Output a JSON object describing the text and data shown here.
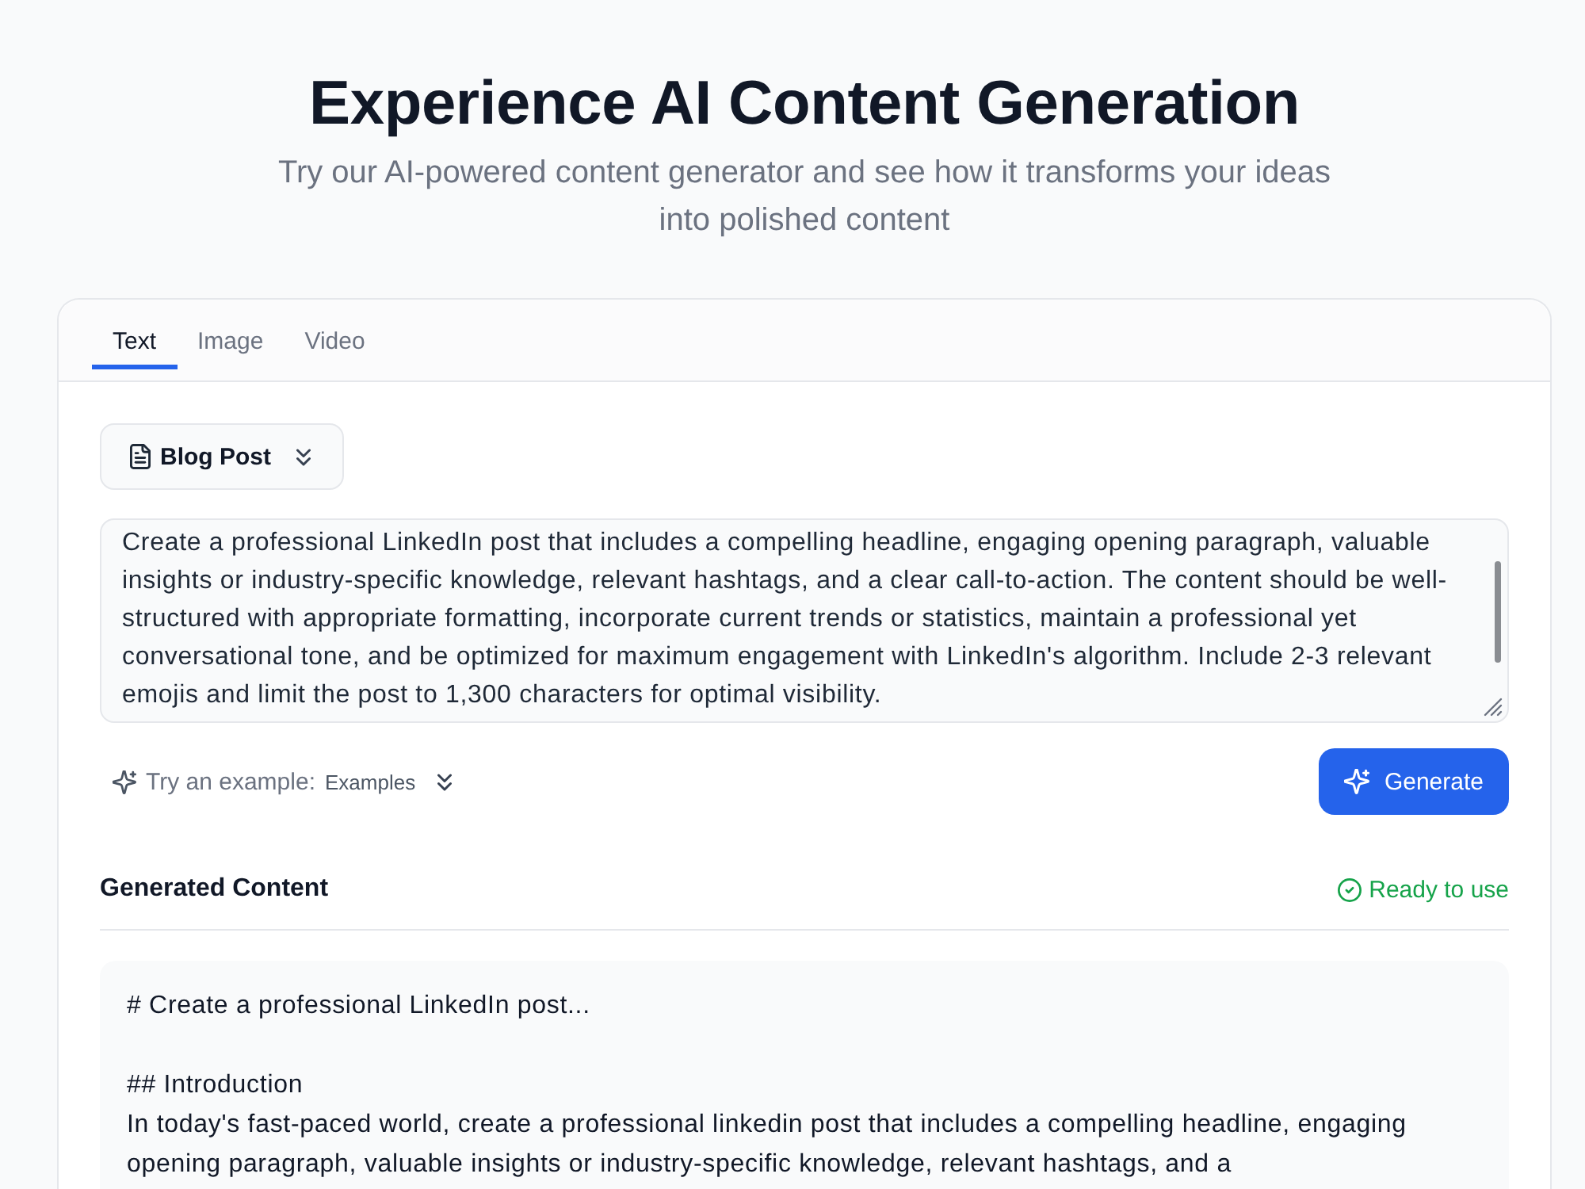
{
  "header": {
    "title": "Experience AI Content Generation",
    "subtitle": "Try our AI-powered content generator and see how it transforms your ideas into polished content"
  },
  "tabs": [
    {
      "label": "Text",
      "selected": true
    },
    {
      "label": "Image",
      "selected": false
    },
    {
      "label": "Video",
      "selected": false
    }
  ],
  "template_dropdown": {
    "label": "Blog Post"
  },
  "prompt": {
    "value": "Create a professional LinkedIn post that includes a compelling headline, engaging opening paragraph, valuable insights or industry-specific knowledge, relevant hashtags, and a clear call-to-action. The content should be well-structured with appropriate formatting, incorporate current trends or statistics, maintain a professional yet conversational tone, and be optimized for maximum engagement with LinkedIn's algorithm. Include 2-3 relevant emojis and limit the post to 1,300 characters for optimal visibility."
  },
  "examples": {
    "label": "Try an example:",
    "dropdown_label": "Examples"
  },
  "generate_button": {
    "label": "Generate"
  },
  "output": {
    "title": "Generated Content",
    "status": "Ready to use",
    "sections": [
      {
        "lines": [
          "# Create a professional LinkedIn post..."
        ]
      },
      {
        "lines": [
          "## Introduction",
          "In today's fast-paced world, create a professional linkedin post that includes a compelling headline, engaging opening paragraph, valuable insights or industry-specific knowledge, relevant hashtags, and a"
        ]
      }
    ]
  }
}
